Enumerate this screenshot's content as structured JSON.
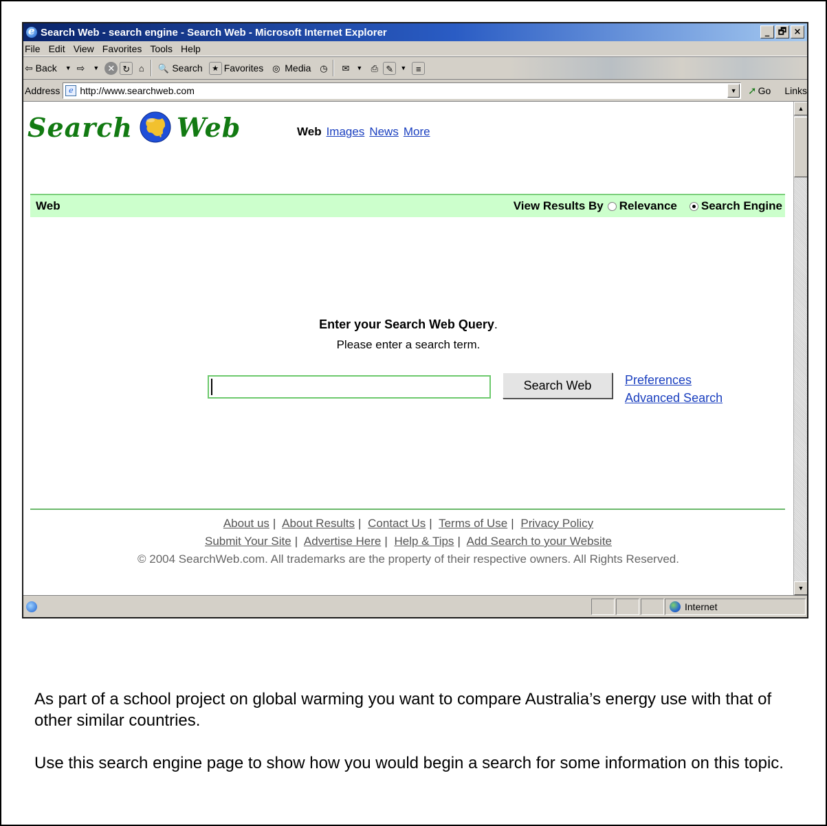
{
  "window": {
    "title": "Search Web - search engine - Search Web - Microsoft Internet Explorer",
    "controls": [
      "_",
      "🗗",
      "×"
    ]
  },
  "menubar": [
    "File",
    "Edit",
    "View",
    "Favorites",
    "Tools",
    "Help"
  ],
  "toolbar": {
    "back": "Back",
    "search": "Search",
    "favorites": "Favorites",
    "media": "Media"
  },
  "addressbar": {
    "label": "Address",
    "value": "http://www.searchweb.com",
    "go": "Go",
    "links": "Links"
  },
  "page": {
    "logo_left": "Search",
    "logo_right": "Web",
    "nav": {
      "active": "Web",
      "links": [
        "Images",
        "News",
        "More"
      ]
    },
    "bar": {
      "section": "Web",
      "view_by": "View Results By",
      "option_relevance": "Relevance",
      "option_engine": "Search Engine",
      "selected": "Search Engine"
    },
    "query_heading": "Enter your Search Web Query",
    "query_sub": "Please enter a search term.",
    "search_value": "",
    "search_button": "Search Web",
    "preferences": "Preferences",
    "advanced": "Advanced Search",
    "footer_row1": [
      "About us",
      "About Results",
      "Contact Us",
      "Terms of Use",
      "Privacy Policy"
    ],
    "footer_row2": [
      "Submit Your Site",
      "Advertise Here",
      "Help & Tips",
      "Add Search to your Website"
    ],
    "copyright": "© 2004 SearchWeb.com. All trademarks are the property of their respective owners. All Rights Reserved."
  },
  "statusbar": {
    "zone": "Internet"
  },
  "instructions": {
    "paragraph1": "As part of a school project on global warming you want to compare Australia’s energy use with that of other similar countries.",
    "paragraph2": "Use this search engine page to show how you would begin a search for some information on this topic."
  },
  "colors": {
    "logo_green": "#127a12",
    "bar_green": "#ccffcc",
    "link_blue": "#1a3fbf",
    "titlebar_blue": "#0a246a"
  }
}
